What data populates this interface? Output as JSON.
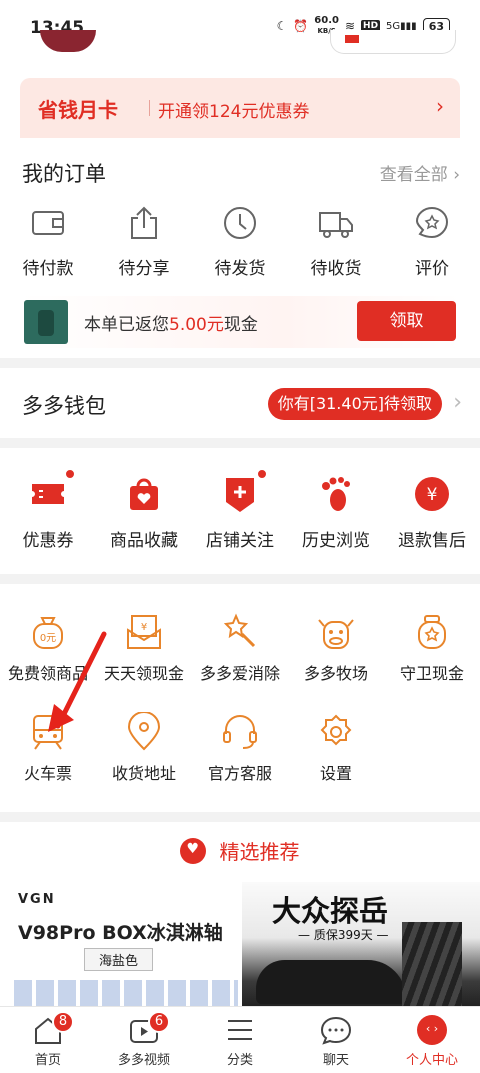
{
  "status_bar": {
    "time": "13:45",
    "speed_value": "60.0",
    "speed_unit": "KB/S",
    "hd": "HD",
    "network": "5G",
    "battery": "63"
  },
  "monthly_card": {
    "title": "省钱月卡",
    "subtitle": "开通领124元优惠券",
    "chevron": "›"
  },
  "orders": {
    "title": "我的订单",
    "view_all": "查看全部",
    "items": [
      {
        "label": "待付款",
        "icon": "wallet-icon"
      },
      {
        "label": "待分享",
        "icon": "share-icon"
      },
      {
        "label": "待发货",
        "icon": "clock-icon"
      },
      {
        "label": "待收货",
        "icon": "truck-icon"
      },
      {
        "label": "评价",
        "icon": "review-icon"
      }
    ],
    "cashback": {
      "prefix": "本单已返您",
      "amount": "5.00元",
      "suffix": "现金",
      "button": "领取"
    }
  },
  "wallet": {
    "title": "多多钱包",
    "badge": "你有[31.40元]待领取"
  },
  "tools": [
    {
      "label": "优惠券",
      "icon": "coupon-icon",
      "dot": true
    },
    {
      "label": "商品收藏",
      "icon": "favorite-bag-icon",
      "dot": false
    },
    {
      "label": "店铺关注",
      "icon": "store-follow-icon",
      "dot": true
    },
    {
      "label": "历史浏览",
      "icon": "footprint-icon",
      "dot": false
    },
    {
      "label": "退款售后",
      "icon": "refund-icon",
      "dot": false
    }
  ],
  "services": [
    {
      "label": "免费领商品",
      "icon": "free-goods-icon",
      "glyph": "0元"
    },
    {
      "label": "天天领现金",
      "icon": "daily-cash-icon",
      "glyph": "¥"
    },
    {
      "label": "多多爱消除",
      "icon": "star-wand-icon",
      "glyph": ""
    },
    {
      "label": "多多牧场",
      "icon": "cow-icon",
      "glyph": ""
    },
    {
      "label": "守卫现金",
      "icon": "guard-cash-icon",
      "glyph": ""
    },
    {
      "label": "火车票",
      "icon": "train-icon",
      "glyph": ""
    },
    {
      "label": "收货地址",
      "icon": "location-icon",
      "glyph": ""
    },
    {
      "label": "官方客服",
      "icon": "headset-icon",
      "glyph": ""
    },
    {
      "label": "设置",
      "icon": "gear-icon",
      "glyph": ""
    }
  ],
  "recommend": {
    "title": "精选推荐"
  },
  "products": [
    {
      "brand": "VGN",
      "name": "V98Pro BOX冰淇淋轴",
      "tag": "海盐色"
    },
    {
      "headline": "大众探岳",
      "sub": "— 质保399天 —"
    }
  ],
  "tabbar": [
    {
      "label": "首页",
      "badge": "8",
      "icon": "home-icon"
    },
    {
      "label": "多多视频",
      "badge": "6",
      "icon": "video-icon"
    },
    {
      "label": "分类",
      "badge": "",
      "icon": "category-icon"
    },
    {
      "label": "聊天",
      "badge": "",
      "icon": "chat-icon"
    },
    {
      "label": "个人中心",
      "badge": "",
      "icon": "profile-icon"
    }
  ],
  "colors": {
    "accent": "#e02e24",
    "service_orange": "#e8852b"
  }
}
